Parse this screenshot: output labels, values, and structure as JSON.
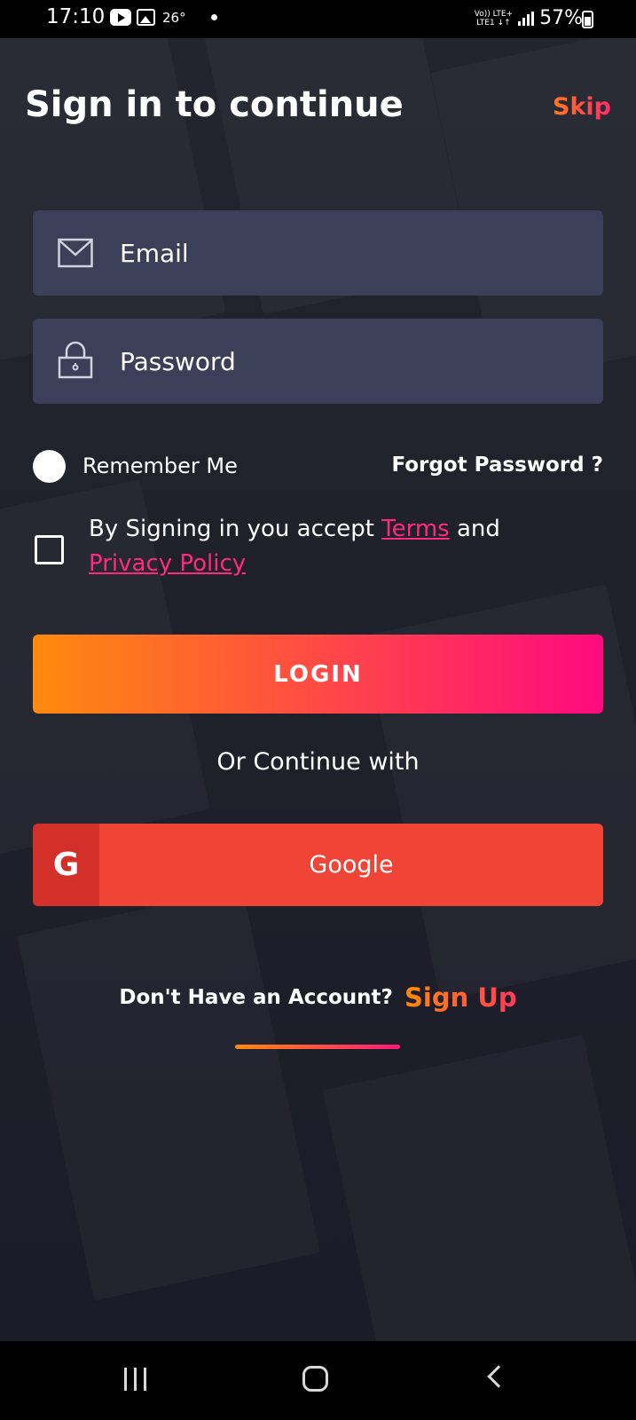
{
  "status_bar": {
    "time": "17:10",
    "temperature": "26°",
    "network_top": "Vo)) LTE+",
    "network_bottom": "LTE1 ↓↑",
    "battery": "57%"
  },
  "header": {
    "title": "Sign in to continue",
    "skip_label": "Skip"
  },
  "form": {
    "email_placeholder": "Email",
    "password_placeholder": "Password",
    "remember_label": "Remember Me",
    "forgot_label": "Forgot Password ?",
    "terms_prefix": "By Signing in you accept ",
    "terms_link": "Terms",
    "terms_and": " and ",
    "privacy_link": "Privacy Policy",
    "login_label": "LOGIN"
  },
  "social": {
    "or_text": "Or Continue with",
    "google_icon_glyph": "G",
    "google_label": "Google"
  },
  "footer": {
    "signup_question": "Don't Have an Account?",
    "signup_link": "Sign Up"
  },
  "icons": {
    "email": "envelope-icon",
    "password": "lock-icon",
    "google": "google-icon"
  },
  "colors": {
    "field_bg": "#3b3f57",
    "accent_orange": "#ff8a0d",
    "accent_pink": "#ff0a7e",
    "google_red": "#ef4436"
  }
}
